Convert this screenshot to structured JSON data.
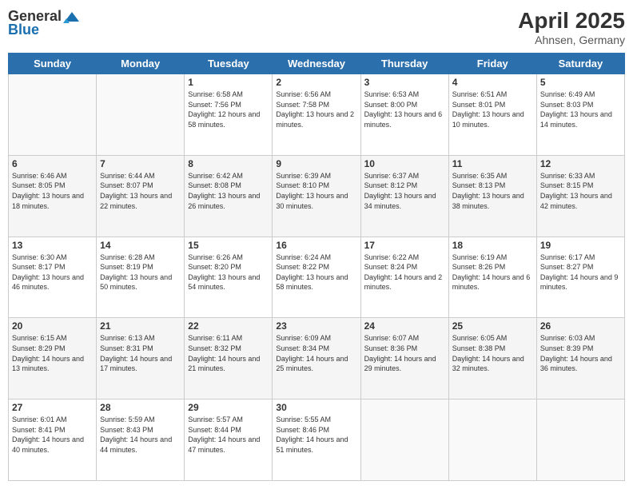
{
  "header": {
    "logo_general": "General",
    "logo_blue": "Blue",
    "month_year": "April 2025",
    "location": "Ahnsen, Germany"
  },
  "days_of_week": [
    "Sunday",
    "Monday",
    "Tuesday",
    "Wednesday",
    "Thursday",
    "Friday",
    "Saturday"
  ],
  "weeks": [
    [
      {
        "day": "",
        "sunrise": "",
        "sunset": "",
        "daylight": ""
      },
      {
        "day": "",
        "sunrise": "",
        "sunset": "",
        "daylight": ""
      },
      {
        "day": "1",
        "sunrise": "Sunrise: 6:58 AM",
        "sunset": "Sunset: 7:56 PM",
        "daylight": "Daylight: 12 hours and 58 minutes."
      },
      {
        "day": "2",
        "sunrise": "Sunrise: 6:56 AM",
        "sunset": "Sunset: 7:58 PM",
        "daylight": "Daylight: 13 hours and 2 minutes."
      },
      {
        "day": "3",
        "sunrise": "Sunrise: 6:53 AM",
        "sunset": "Sunset: 8:00 PM",
        "daylight": "Daylight: 13 hours and 6 minutes."
      },
      {
        "day": "4",
        "sunrise": "Sunrise: 6:51 AM",
        "sunset": "Sunset: 8:01 PM",
        "daylight": "Daylight: 13 hours and 10 minutes."
      },
      {
        "day": "5",
        "sunrise": "Sunrise: 6:49 AM",
        "sunset": "Sunset: 8:03 PM",
        "daylight": "Daylight: 13 hours and 14 minutes."
      }
    ],
    [
      {
        "day": "6",
        "sunrise": "Sunrise: 6:46 AM",
        "sunset": "Sunset: 8:05 PM",
        "daylight": "Daylight: 13 hours and 18 minutes."
      },
      {
        "day": "7",
        "sunrise": "Sunrise: 6:44 AM",
        "sunset": "Sunset: 8:07 PM",
        "daylight": "Daylight: 13 hours and 22 minutes."
      },
      {
        "day": "8",
        "sunrise": "Sunrise: 6:42 AM",
        "sunset": "Sunset: 8:08 PM",
        "daylight": "Daylight: 13 hours and 26 minutes."
      },
      {
        "day": "9",
        "sunrise": "Sunrise: 6:39 AM",
        "sunset": "Sunset: 8:10 PM",
        "daylight": "Daylight: 13 hours and 30 minutes."
      },
      {
        "day": "10",
        "sunrise": "Sunrise: 6:37 AM",
        "sunset": "Sunset: 8:12 PM",
        "daylight": "Daylight: 13 hours and 34 minutes."
      },
      {
        "day": "11",
        "sunrise": "Sunrise: 6:35 AM",
        "sunset": "Sunset: 8:13 PM",
        "daylight": "Daylight: 13 hours and 38 minutes."
      },
      {
        "day": "12",
        "sunrise": "Sunrise: 6:33 AM",
        "sunset": "Sunset: 8:15 PM",
        "daylight": "Daylight: 13 hours and 42 minutes."
      }
    ],
    [
      {
        "day": "13",
        "sunrise": "Sunrise: 6:30 AM",
        "sunset": "Sunset: 8:17 PM",
        "daylight": "Daylight: 13 hours and 46 minutes."
      },
      {
        "day": "14",
        "sunrise": "Sunrise: 6:28 AM",
        "sunset": "Sunset: 8:19 PM",
        "daylight": "Daylight: 13 hours and 50 minutes."
      },
      {
        "day": "15",
        "sunrise": "Sunrise: 6:26 AM",
        "sunset": "Sunset: 8:20 PM",
        "daylight": "Daylight: 13 hours and 54 minutes."
      },
      {
        "day": "16",
        "sunrise": "Sunrise: 6:24 AM",
        "sunset": "Sunset: 8:22 PM",
        "daylight": "Daylight: 13 hours and 58 minutes."
      },
      {
        "day": "17",
        "sunrise": "Sunrise: 6:22 AM",
        "sunset": "Sunset: 8:24 PM",
        "daylight": "Daylight: 14 hours and 2 minutes."
      },
      {
        "day": "18",
        "sunrise": "Sunrise: 6:19 AM",
        "sunset": "Sunset: 8:26 PM",
        "daylight": "Daylight: 14 hours and 6 minutes."
      },
      {
        "day": "19",
        "sunrise": "Sunrise: 6:17 AM",
        "sunset": "Sunset: 8:27 PM",
        "daylight": "Daylight: 14 hours and 9 minutes."
      }
    ],
    [
      {
        "day": "20",
        "sunrise": "Sunrise: 6:15 AM",
        "sunset": "Sunset: 8:29 PM",
        "daylight": "Daylight: 14 hours and 13 minutes."
      },
      {
        "day": "21",
        "sunrise": "Sunrise: 6:13 AM",
        "sunset": "Sunset: 8:31 PM",
        "daylight": "Daylight: 14 hours and 17 minutes."
      },
      {
        "day": "22",
        "sunrise": "Sunrise: 6:11 AM",
        "sunset": "Sunset: 8:32 PM",
        "daylight": "Daylight: 14 hours and 21 minutes."
      },
      {
        "day": "23",
        "sunrise": "Sunrise: 6:09 AM",
        "sunset": "Sunset: 8:34 PM",
        "daylight": "Daylight: 14 hours and 25 minutes."
      },
      {
        "day": "24",
        "sunrise": "Sunrise: 6:07 AM",
        "sunset": "Sunset: 8:36 PM",
        "daylight": "Daylight: 14 hours and 29 minutes."
      },
      {
        "day": "25",
        "sunrise": "Sunrise: 6:05 AM",
        "sunset": "Sunset: 8:38 PM",
        "daylight": "Daylight: 14 hours and 32 minutes."
      },
      {
        "day": "26",
        "sunrise": "Sunrise: 6:03 AM",
        "sunset": "Sunset: 8:39 PM",
        "daylight": "Daylight: 14 hours and 36 minutes."
      }
    ],
    [
      {
        "day": "27",
        "sunrise": "Sunrise: 6:01 AM",
        "sunset": "Sunset: 8:41 PM",
        "daylight": "Daylight: 14 hours and 40 minutes."
      },
      {
        "day": "28",
        "sunrise": "Sunrise: 5:59 AM",
        "sunset": "Sunset: 8:43 PM",
        "daylight": "Daylight: 14 hours and 44 minutes."
      },
      {
        "day": "29",
        "sunrise": "Sunrise: 5:57 AM",
        "sunset": "Sunset: 8:44 PM",
        "daylight": "Daylight: 14 hours and 47 minutes."
      },
      {
        "day": "30",
        "sunrise": "Sunrise: 5:55 AM",
        "sunset": "Sunset: 8:46 PM",
        "daylight": "Daylight: 14 hours and 51 minutes."
      },
      {
        "day": "",
        "sunrise": "",
        "sunset": "",
        "daylight": ""
      },
      {
        "day": "",
        "sunrise": "",
        "sunset": "",
        "daylight": ""
      },
      {
        "day": "",
        "sunrise": "",
        "sunset": "",
        "daylight": ""
      }
    ]
  ]
}
